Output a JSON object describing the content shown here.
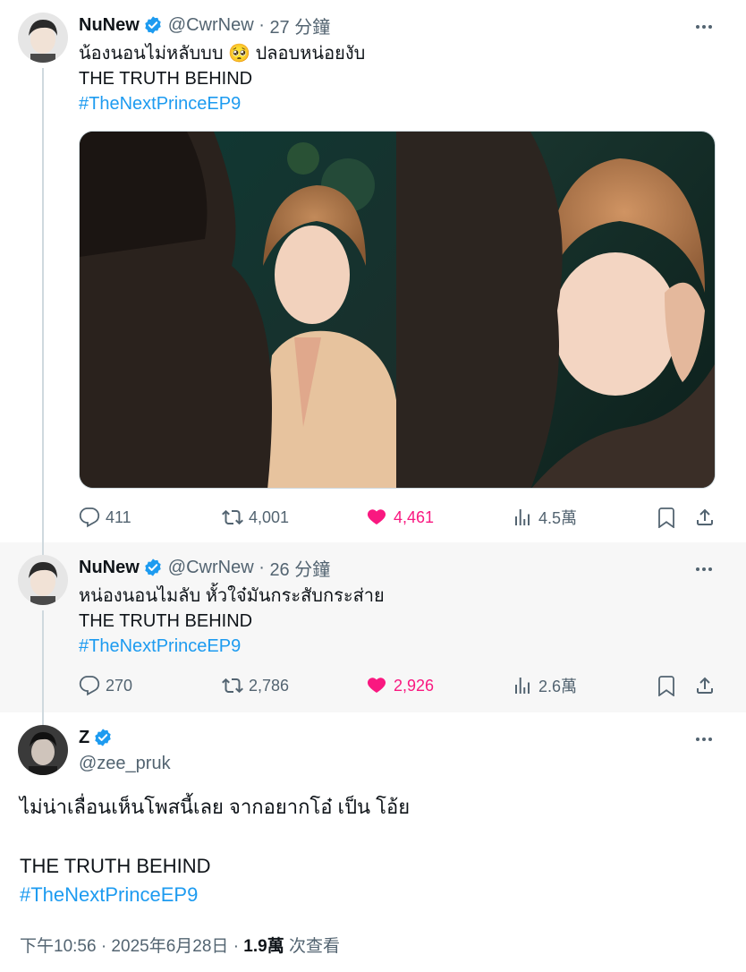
{
  "tweets": [
    {
      "name": "NuNew",
      "handle": "@CwrNew",
      "time": "27 分鐘",
      "text_lines": [
        "น้องนอนไม่หลับบบ 🥺 ปลอบหน่อยงับ",
        "THE TRUTH BEHIND"
      ],
      "hashtag": "#TheNextPrinceEP9",
      "stats": {
        "replies": "411",
        "retweets": "4,001",
        "likes": "4,461",
        "views": "4.5萬"
      }
    },
    {
      "name": "NuNew",
      "handle": "@CwrNew",
      "time": "26 分鐘",
      "text_lines": [
        "หน่องนอนไมลับ หั้วใจ๋มันกระสับกระส่าย",
        "THE TRUTH BEHIND"
      ],
      "hashtag": "#TheNextPrinceEP9",
      "stats": {
        "replies": "270",
        "retweets": "2,786",
        "likes": "2,926",
        "views": "2.6萬"
      }
    }
  ],
  "main_tweet": {
    "name": "Z",
    "handle": "@zee_pruk",
    "text_line1": "ไม่น่าเลื่อนเห็นโพสนี้เลย จากอยากโอ๋ เป็น โอ้ย",
    "text_line2": "THE TRUTH BEHIND",
    "hashtag": "#TheNextPrinceEP9",
    "timestamp": "下午10:56 · 2025年6月28日",
    "views_count": "1.9萬",
    "views_label": "次查看"
  },
  "colors": {
    "accent": "#1d9bf0",
    "like": "#f91880",
    "muted": "#536471"
  },
  "icons": [
    "verified-badge-icon",
    "more-icon",
    "reply-icon",
    "retweet-icon",
    "like-icon",
    "views-icon",
    "bookmark-icon",
    "share-icon"
  ]
}
